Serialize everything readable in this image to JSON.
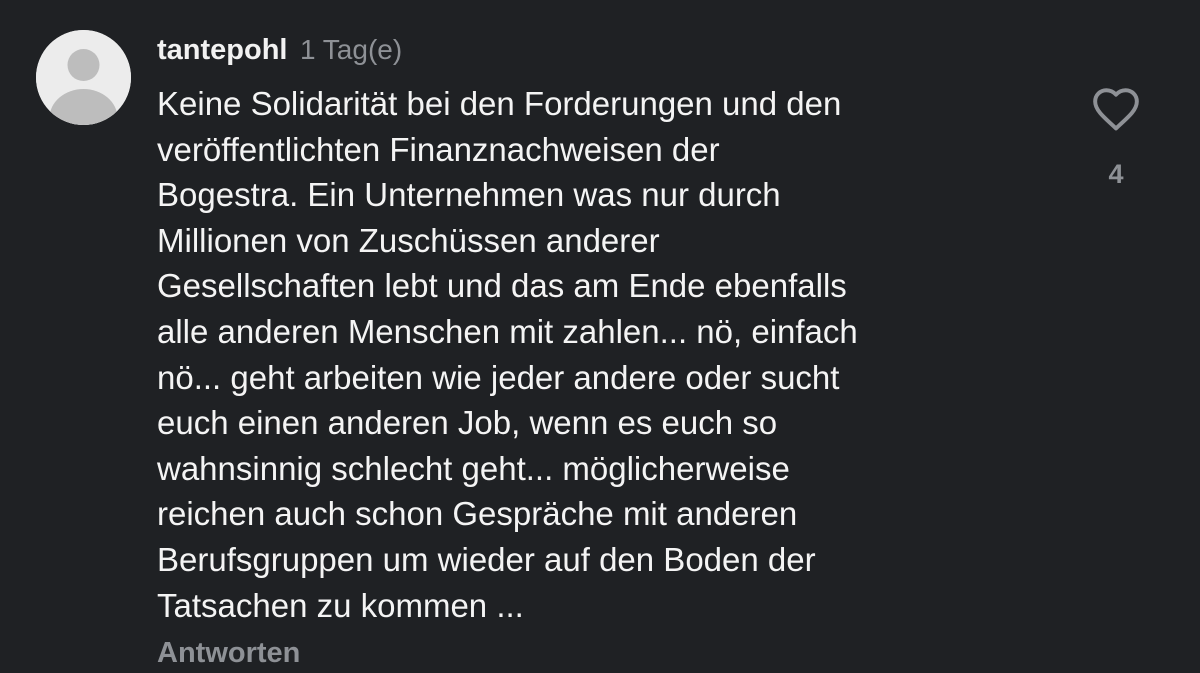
{
  "comment": {
    "username": "tantepohl",
    "timestamp": "1 Tag(e)",
    "body_lines": [
      "Keine Solidarität bei den Forderungen und den",
      "veröffentlichten Finanznachweisen der",
      "Bogestra. Ein Unternehmen was nur durch",
      "Millionen von Zuschüssen anderer",
      "Gesellschaften lebt und das am Ende ebenfalls",
      "alle anderen Menschen mit zahlen... nö, einfach",
      "nö... geht arbeiten wie jeder andere oder sucht",
      "euch einen anderen Job, wenn es euch so",
      "wahnsinnig schlecht geht... möglicherweise",
      "reichen auch schon Gespräche mit anderen",
      "Berufsgruppen um wieder auf den Boden der",
      "Tatsachen zu kommen ..."
    ],
    "like_count": "4",
    "reply_label": "Antworten",
    "avatar_icon": "default-user-avatar-icon",
    "like_icon": "heart-outline-icon"
  },
  "colors": {
    "background": "#1f2124",
    "text_primary": "#f4f4f4",
    "text_secondary": "#8e9196",
    "avatar_background": "#ececec",
    "avatar_silhouette": "#bdbdbd"
  }
}
